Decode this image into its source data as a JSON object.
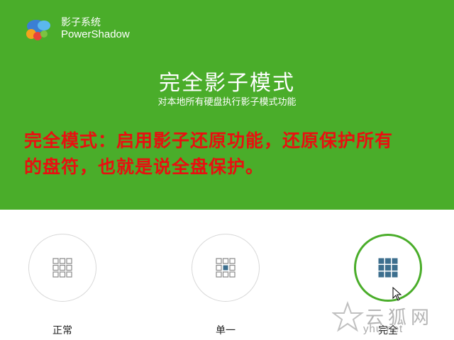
{
  "brand": {
    "name_cn": "影子系统",
    "name_en": "PowerShadow"
  },
  "mode": {
    "title": "完全影子模式",
    "subtitle": "对本地所有硬盘执行影子模式功能"
  },
  "annotation": {
    "line1": "完全模式：启用影子还原功能，还原保护所有",
    "line2": "的盘符，也就是说全盘保护。"
  },
  "modes": [
    {
      "label": "正常",
      "icon": "grid-empty-icon"
    },
    {
      "label": "单一",
      "icon": "grid-single-icon"
    },
    {
      "label": "完全",
      "icon": "grid-full-icon",
      "selected": true
    }
  ],
  "watermark": {
    "text": "云狐网",
    "url": "yhu.net"
  },
  "colors": {
    "header_green": "#4aad2a",
    "annotation_red": "#e81010",
    "icon_blue": "#3d6f8e"
  }
}
